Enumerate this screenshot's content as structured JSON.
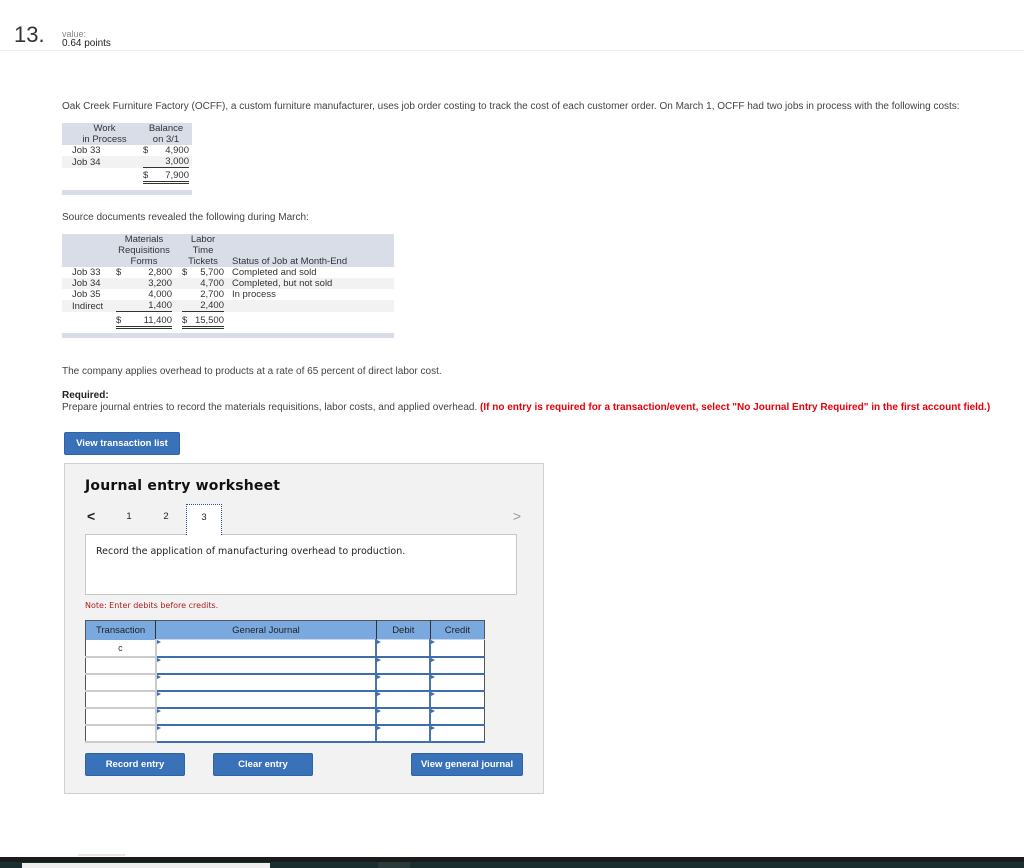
{
  "question": {
    "number": "13.",
    "value_label": "value:",
    "points": "0.64 points"
  },
  "intro": "Oak Creek Furniture Factory (OCFF), a custom furniture manufacturer, uses job order costing to track the cost of each customer order. On March 1, OCFF had two jobs in process with the following costs:",
  "wip_table": {
    "headers": [
      "Work\nin Process",
      "Balance\non 3/1"
    ],
    "header_col1": [
      "Work",
      "in Process"
    ],
    "header_col2": [
      "Balance",
      "on 3/1"
    ],
    "rows": [
      {
        "label": "Job 33",
        "currency": "$",
        "value": "4,900"
      },
      {
        "label": "Job 34",
        "currency": "",
        "value": "3,000"
      }
    ],
    "total": {
      "currency": "$",
      "value": "7,900"
    }
  },
  "source_intro": "Source documents revealed the following during March:",
  "march_table": {
    "header_materials": [
      "Materials",
      "Requisitions",
      "Forms"
    ],
    "header_labor": [
      "Labor Time",
      "Tickets"
    ],
    "header_status": "Status of Job at Month-End",
    "rows": [
      {
        "label": "Job 33",
        "mat_cur": "$",
        "materials": "2,800",
        "lab_cur": "$",
        "labor": "5,700",
        "status": "Completed and sold"
      },
      {
        "label": "Job 34",
        "mat_cur": "",
        "materials": "3,200",
        "lab_cur": "",
        "labor": "4,700",
        "status": "Completed, but not sold"
      },
      {
        "label": "Job 35",
        "mat_cur": "",
        "materials": "4,000",
        "lab_cur": "",
        "labor": "2,700",
        "status": "In process"
      },
      {
        "label": "Indirect",
        "mat_cur": "",
        "materials": "1,400",
        "lab_cur": "",
        "labor": "2,400",
        "status": ""
      }
    ],
    "totals": {
      "mat_cur": "$",
      "materials": "11,400",
      "lab_cur": "$",
      "labor": "15,500"
    }
  },
  "overhead_text": "The company applies overhead to products at a rate of 65 percent of direct labor cost.",
  "required": {
    "label": "Required:",
    "text": "Prepare journal entries to record the materials requisitions, labor costs, and applied overhead. ",
    "warning": "(If no entry is required for a transaction/event, select \"No Journal Entry Required\" in the first account field.)"
  },
  "buttons": {
    "view_transaction_list": "View transaction list",
    "record_entry": "Record entry",
    "clear_entry": "Clear entry",
    "view_general_journal": "View general journal"
  },
  "worksheet": {
    "title": "Journal entry worksheet",
    "prev_icon": "<",
    "next_icon": ">",
    "tabs": [
      "1",
      "2",
      "3"
    ],
    "active_tab": "3",
    "description": "Record the application of manufacturing overhead to production.",
    "note": "Note: Enter debits before credits.",
    "columns": [
      "Transaction",
      "General Journal",
      "Debit",
      "Credit"
    ],
    "rows": [
      {
        "transaction": "c",
        "account": "",
        "debit": "",
        "credit": ""
      },
      {
        "transaction": "",
        "account": "",
        "debit": "",
        "credit": ""
      },
      {
        "transaction": "",
        "account": "",
        "debit": "",
        "credit": ""
      },
      {
        "transaction": "",
        "account": "",
        "debit": "",
        "credit": ""
      },
      {
        "transaction": "",
        "account": "",
        "debit": "",
        "credit": ""
      },
      {
        "transaction": "",
        "account": "",
        "debit": "",
        "credit": ""
      }
    ]
  },
  "colors": {
    "button_blue": "#3a72b9",
    "table_header_blue": "#7aa9e0",
    "warning_red": "#e8000b",
    "note_red": "#b0201f",
    "data_table_header": "#d9dde8"
  }
}
